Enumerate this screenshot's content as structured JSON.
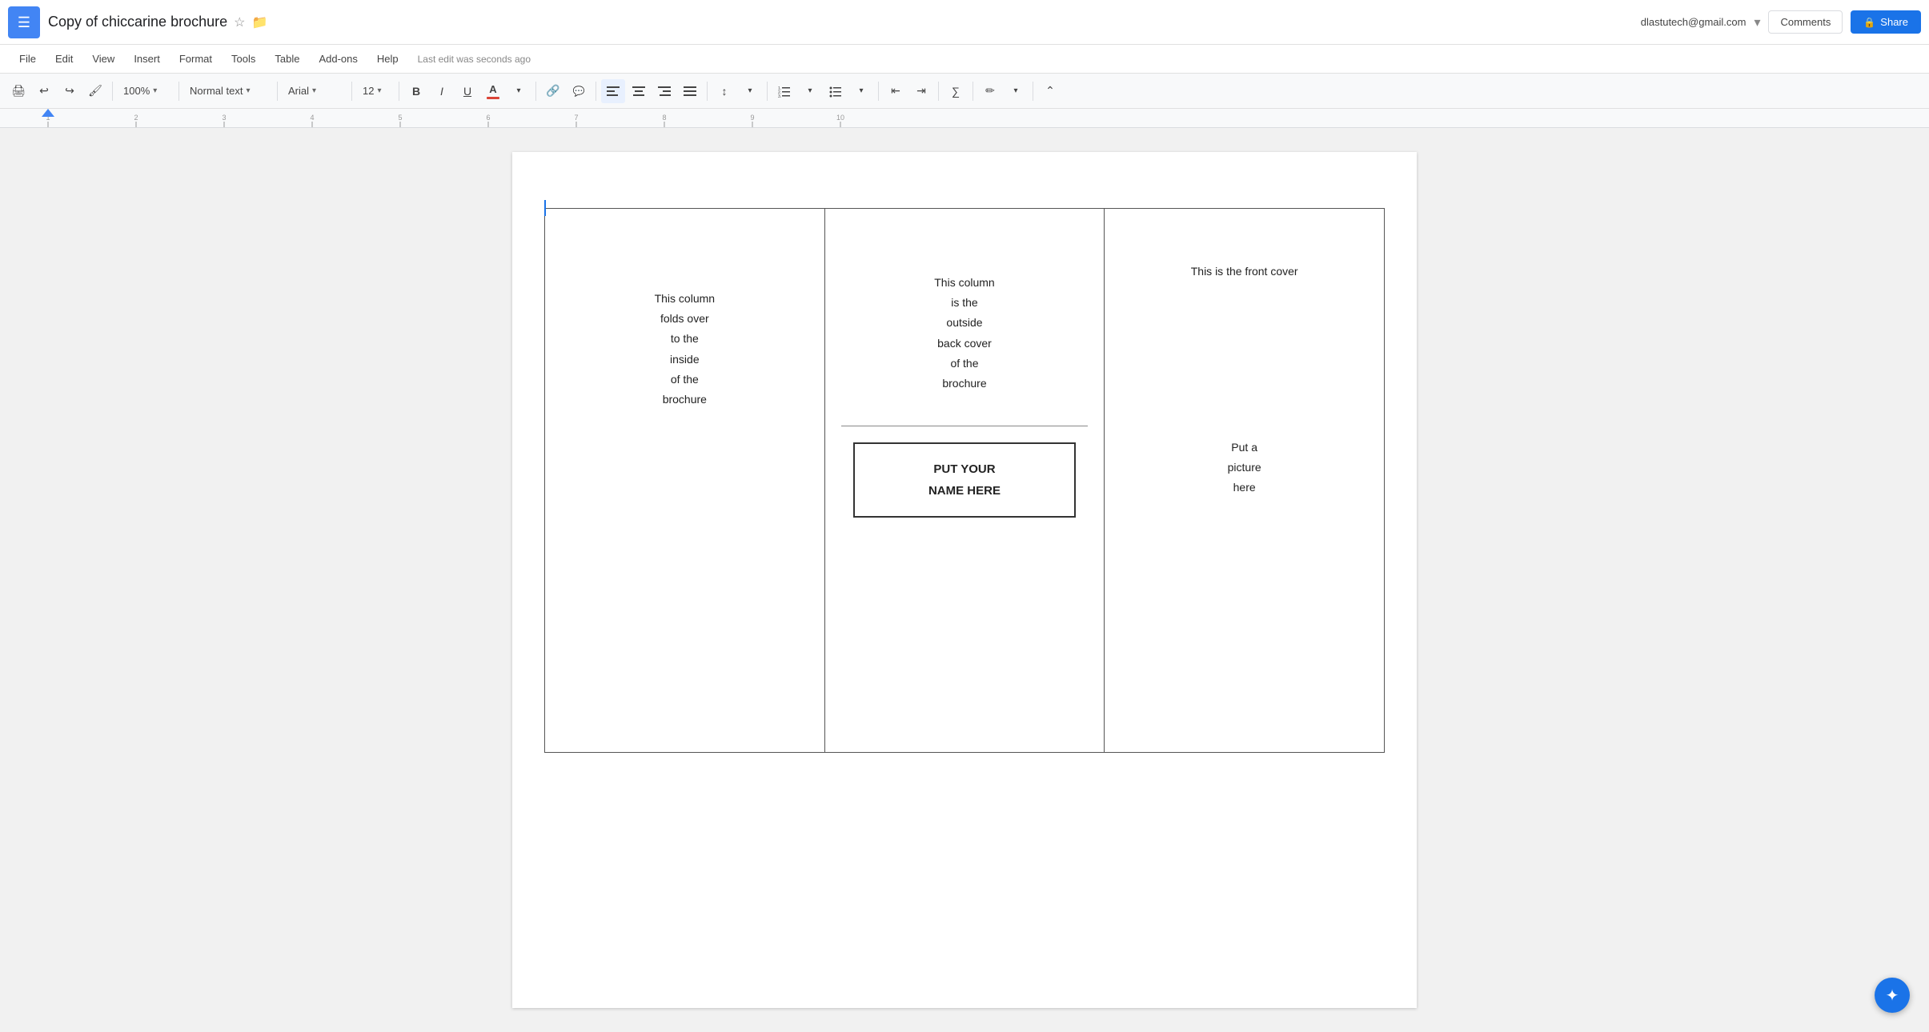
{
  "app": {
    "menu_icon": "☰",
    "title": "Copy of chiccarine brochure",
    "star_icon": "☆",
    "folder_icon": "📁"
  },
  "top_right": {
    "user_email": "dlastutech@gmail.com",
    "dropdown_icon": "▾",
    "comments_label": "Comments",
    "share_label": "Share",
    "lock_icon": "🔒"
  },
  "menu": {
    "items": [
      "File",
      "Edit",
      "View",
      "Insert",
      "Format",
      "Tools",
      "Table",
      "Add-ons",
      "Help"
    ],
    "last_edit": "Last edit was seconds ago"
  },
  "toolbar": {
    "zoom": "100%",
    "style": "Normal text",
    "font": "Arial",
    "size": "12",
    "bold": "B",
    "italic": "I",
    "underline": "U",
    "color_icon": "A",
    "link_icon": "🔗",
    "comment_icon": "💬",
    "align_left": "≡",
    "align_center": "≡",
    "align_right": "≡",
    "align_justify": "≡",
    "line_spacing": "↕",
    "num_list": "1.",
    "bullet_list": "•",
    "indent_less": "⇤",
    "indent_more": "⇥",
    "formula": "∑",
    "pencil": "✏",
    "collapse": "⌃"
  },
  "brochure": {
    "col1": {
      "text": "This column\nfolds over\nto the\ninside\nof the\nbrochure"
    },
    "col2": {
      "top_text": "This column\nis the\noutside\nback cover\nof the\nbrochure",
      "name_box": "PUT YOUR\nNAME HERE"
    },
    "col3": {
      "front_cover": "This is the front cover",
      "picture_text": "Put a\npicture\nhere"
    }
  },
  "ai_button": "✦"
}
